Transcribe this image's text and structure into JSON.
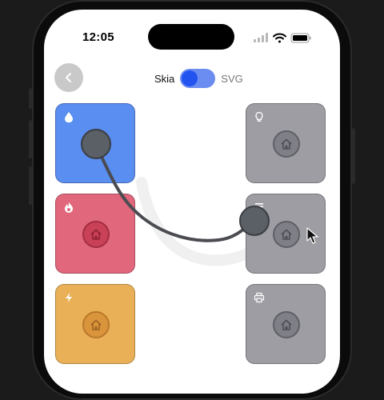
{
  "status_bar": {
    "time": "12:05"
  },
  "header": {
    "toggle": {
      "left_label": "Skia",
      "right_label": "SVG",
      "state": "Skia"
    }
  },
  "tiles_left": [
    {
      "id": "water",
      "icon": "water-drop-icon",
      "color": "#5a8ef0",
      "center_icon": "home-icon"
    },
    {
      "id": "fire",
      "icon": "fire-icon",
      "color": "#e0677c",
      "center_icon": "home-icon"
    },
    {
      "id": "power",
      "icon": "lightning-icon",
      "color": "#eab058",
      "center_icon": "home-icon"
    }
  ],
  "tiles_right": [
    {
      "id": "light",
      "icon": "lightbulb-icon",
      "color": "#9d9da3",
      "center_icon": "home-icon"
    },
    {
      "id": "list",
      "icon": "list-icon",
      "color": "#9d9da3",
      "center_icon": "home-icon"
    },
    {
      "id": "printer",
      "icon": "printer-icon",
      "color": "#9d9da3",
      "center_icon": "home-icon"
    }
  ],
  "colors": {
    "accent_blue": "#2354ef",
    "toggle_track": "#6b8cf0",
    "connector": "#4a4c52",
    "inactive_tile": "#9d9da3"
  }
}
